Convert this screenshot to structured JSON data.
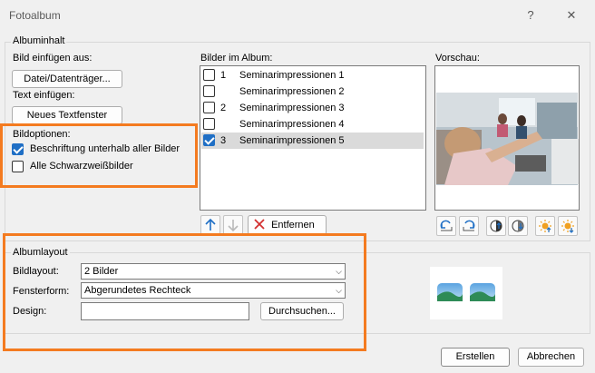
{
  "window": {
    "title": "Fotoalbum",
    "help_label": "?",
    "close_label": "✕"
  },
  "album_content": {
    "legend": "Albuminhalt",
    "insert_image_label": "Bild einfügen aus:",
    "file_button": "Datei/Datenträger...",
    "insert_text_label": "Text einfügen:",
    "new_textbox_button": "Neues Textfenster"
  },
  "image_options": {
    "legend": "Bildoptionen:",
    "caption_below": {
      "label": "Beschriftung unterhalb aller Bilder",
      "checked": true
    },
    "grayscale": {
      "label": "Alle Schwarzweißbilder",
      "checked": false
    }
  },
  "pictures": {
    "label": "Bilder im Album:",
    "items": [
      {
        "num": "1",
        "name": "Seminarimpressionen 1",
        "checked": false,
        "selected": false
      },
      {
        "num": "",
        "name": "Seminarimpressionen 2",
        "checked": false,
        "selected": false
      },
      {
        "num": "2",
        "name": "Seminarimpressionen 3",
        "checked": false,
        "selected": false
      },
      {
        "num": "",
        "name": "Seminarimpressionen 4",
        "checked": false,
        "selected": false
      },
      {
        "num": "3",
        "name": "Seminarimpressionen 5",
        "checked": true,
        "selected": true
      }
    ],
    "remove_button": "Entfernen"
  },
  "preview": {
    "label": "Vorschau:"
  },
  "layout": {
    "legend": "Albumlayout",
    "picture_layout_label": "Bildlayout:",
    "picture_layout_value": "2 Bilder",
    "frame_shape_label": "Fensterform:",
    "frame_shape_value": "Abgerundetes Rechteck",
    "design_label": "Design:",
    "design_value": "",
    "browse_button": "Durchsuchen..."
  },
  "footer": {
    "create_button": "Erstellen",
    "cancel_button": "Abbrechen"
  },
  "colors": {
    "accent": "#1f6fc5",
    "highlight": "#f47b20",
    "remove_x": "#d32f2f"
  }
}
